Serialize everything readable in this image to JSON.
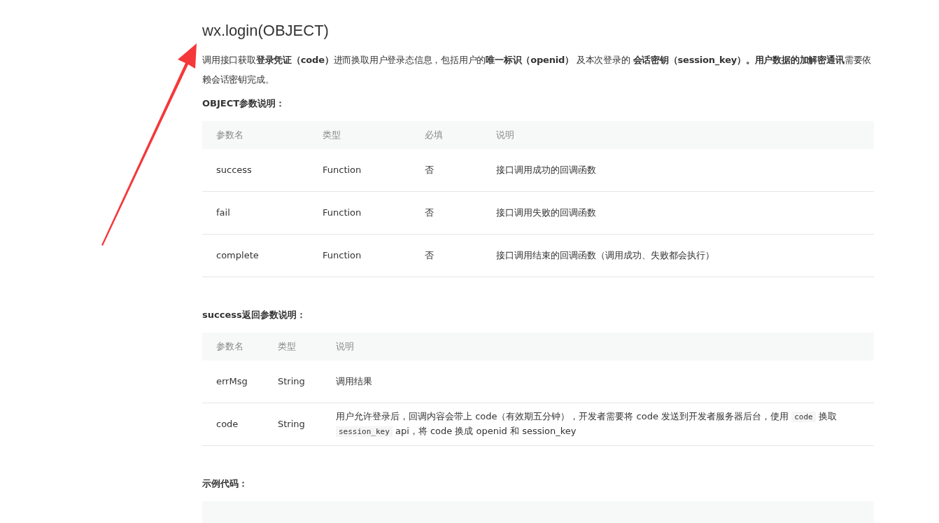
{
  "title": "wx.login(OBJECT)",
  "intro": "调用接口获取**登录凭证（code）**进而换取用户登录态信息，包括用户的**唯一标识（openid）** 及本次登录的 **会话密钥（session_key）。用户数据的加解密通讯**需要依赖会话密钥完成。",
  "sections": [
    {
      "heading": "OBJECT参数说明：",
      "table": {
        "columns": [
          "参数名",
          "类型",
          "必填",
          "说明"
        ],
        "rows": [
          {
            "cells": [
              [
                {
                  "kind": "text",
                  "text": "success"
                }
              ],
              [
                {
                  "kind": "text",
                  "text": "Function"
                }
              ],
              [
                {
                  "kind": "text",
                  "text": "否"
                }
              ],
              [
                {
                  "kind": "text",
                  "text": "接口调用成功的回调函数"
                }
              ]
            ]
          },
          {
            "cells": [
              [
                {
                  "kind": "text",
                  "text": "fail"
                }
              ],
              [
                {
                  "kind": "text",
                  "text": "Function"
                }
              ],
              [
                {
                  "kind": "text",
                  "text": "否"
                }
              ],
              [
                {
                  "kind": "text",
                  "text": "接口调用失败的回调函数"
                }
              ]
            ]
          },
          {
            "cells": [
              [
                {
                  "kind": "text",
                  "text": "complete"
                }
              ],
              [
                {
                  "kind": "text",
                  "text": "Function"
                }
              ],
              [
                {
                  "kind": "text",
                  "text": "否"
                }
              ],
              [
                {
                  "kind": "text",
                  "text": "接口调用结束的回调函数（调用成功、失败都会执行）"
                }
              ]
            ]
          }
        ]
      }
    },
    {
      "heading": "success返回参数说明：",
      "table": {
        "columns": [
          "参数名",
          "类型",
          "说明"
        ],
        "rows": [
          {
            "cells": [
              [
                {
                  "kind": "text",
                  "text": "errMsg"
                }
              ],
              [
                {
                  "kind": "text",
                  "text": "String"
                }
              ],
              [
                {
                  "kind": "text",
                  "text": "调用结果"
                }
              ]
            ]
          },
          {
            "cells": [
              [
                {
                  "kind": "text",
                  "text": "code"
                }
              ],
              [
                {
                  "kind": "text",
                  "text": "String"
                }
              ],
              [
                {
                  "kind": "text",
                  "text": "用户允许登录后，回调内容会带上 code（有效期五分钟），开发者需要将 code 发送到开发者服务器后台，使用 "
                },
                {
                  "kind": "code",
                  "text": "code"
                },
                {
                  "kind": "text",
                  "text": " 换取 "
                },
                {
                  "kind": "code",
                  "text": "session_key"
                },
                {
                  "kind": "text",
                  "text": " api，将 code 换成 openid 和 session_key"
                }
              ]
            ]
          }
        ]
      }
    }
  ],
  "example": {
    "heading": "示例代码："
  }
}
